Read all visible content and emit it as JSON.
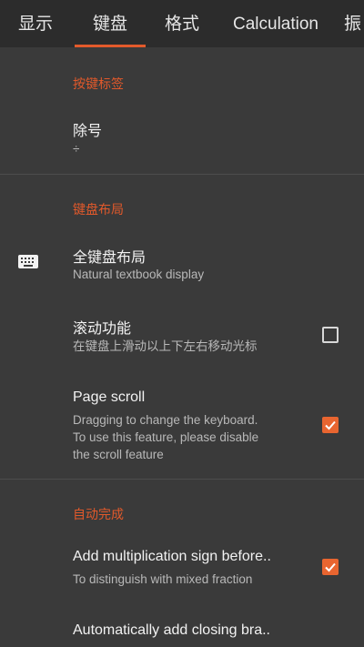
{
  "tabs": [
    {
      "label": "显示"
    },
    {
      "label": "键盘"
    },
    {
      "label": "格式"
    },
    {
      "label": "Calculation"
    },
    {
      "label": "振"
    }
  ],
  "sections": {
    "key_labels": {
      "header": "按键标签",
      "division": {
        "title": "除号",
        "value": "÷"
      }
    },
    "keyboard_layout": {
      "header": "键盘布局",
      "full_layout": {
        "title": "全键盘布局",
        "subtitle": "Natural textbook display",
        "icon": "keyboard-icon"
      },
      "scroll_function": {
        "title": "滚动功能",
        "subtitle": "在键盘上滑动以上下左右移动光标",
        "checked": false
      },
      "page_scroll": {
        "title": "Page scroll",
        "subtitle_lines": [
          "Dragging to change the keyboard.",
          "To use this feature, please disable",
          "the scroll feature"
        ],
        "checked": true
      }
    },
    "autocomplete": {
      "header": "自动完成",
      "add_multiplication": {
        "title": "Add multiplication sign before..",
        "subtitle": "To distinguish with mixed fraction",
        "checked": true
      },
      "auto_closing": {
        "title": "Automatically add closing bra.."
      }
    }
  },
  "colors": {
    "accent": "#e35a2b",
    "background": "#3a3a3a",
    "tabbar": "#2c2c2c"
  }
}
